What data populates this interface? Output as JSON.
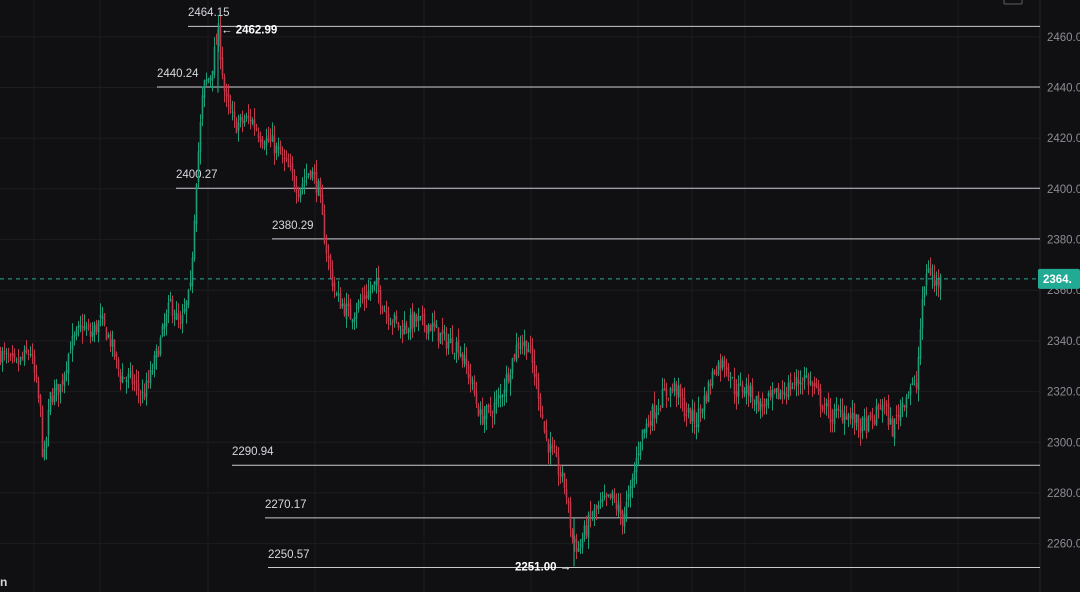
{
  "colors": {
    "background": "#101013",
    "grid": "#1d1d21",
    "level_line": "#c9c9cf",
    "up_candle": "#1e9c78",
    "down_candle": "#c0394a",
    "price_line": "#22ab94",
    "price_tag": "#22ab94"
  },
  "corner_text": "n",
  "icons": {
    "scale_settings": "square-icon"
  },
  "chart_data": {
    "type": "candlestick",
    "title": "",
    "xlabel": "",
    "ylabel": "",
    "ylim": [
      2248,
      2472
    ],
    "grid": true,
    "y_ticks": [
      "2260.00",
      "2280.00",
      "2300.00",
      "2320.00",
      "2340.00",
      "2360.00",
      "2380.00",
      "2400.00",
      "2420.00",
      "2440.00",
      "2460.00"
    ],
    "current_price": {
      "value": 2364.5,
      "label": "2364."
    },
    "levels": [
      {
        "value": 2464.15,
        "label": "2464.15"
      },
      {
        "value": 2440.24,
        "label": "2440.24"
      },
      {
        "value": 2400.27,
        "label": "2400.27"
      },
      {
        "value": 2380.29,
        "label": "2380.29"
      },
      {
        "value": 2290.94,
        "label": "2290.94"
      },
      {
        "value": 2270.17,
        "label": "2270.17"
      },
      {
        "value": 2250.57,
        "label": "2250.57"
      }
    ],
    "extreme_labels": [
      {
        "type": "high",
        "value": 2462.99,
        "text": "← 2462.99"
      },
      {
        "type": "low",
        "value": 2251.0,
        "text": "2251.00 →"
      }
    ],
    "price_path": [
      [
        0,
        2335
      ],
      [
        15,
        2330
      ],
      [
        30,
        2336
      ],
      [
        40,
        2312
      ],
      [
        43,
        2290
      ],
      [
        50,
        2318
      ],
      [
        60,
        2322
      ],
      [
        70,
        2338
      ],
      [
        82,
        2346
      ],
      [
        90,
        2342
      ],
      [
        100,
        2348
      ],
      [
        110,
        2340
      ],
      [
        120,
        2326
      ],
      [
        130,
        2325
      ],
      [
        143,
        2318
      ],
      [
        150,
        2326
      ],
      [
        160,
        2340
      ],
      [
        170,
        2355
      ],
      [
        180,
        2345
      ],
      [
        190,
        2360
      ],
      [
        196,
        2405
      ],
      [
        203,
        2440
      ],
      [
        210,
        2445
      ],
      [
        218,
        2462
      ],
      [
        225,
        2435
      ],
      [
        235,
        2425
      ],
      [
        250,
        2428
      ],
      [
        262,
        2420
      ],
      [
        272,
        2418
      ],
      [
        285,
        2410
      ],
      [
        298,
        2400
      ],
      [
        310,
        2408
      ],
      [
        318,
        2400
      ],
      [
        325,
        2378
      ],
      [
        335,
        2358
      ],
      [
        350,
        2350
      ],
      [
        365,
        2358
      ],
      [
        375,
        2362
      ],
      [
        385,
        2352
      ],
      [
        400,
        2345
      ],
      [
        415,
        2348
      ],
      [
        430,
        2346
      ],
      [
        445,
        2340
      ],
      [
        458,
        2338
      ],
      [
        470,
        2325
      ],
      [
        480,
        2310
      ],
      [
        490,
        2312
      ],
      [
        500,
        2318
      ],
      [
        510,
        2330
      ],
      [
        518,
        2340
      ],
      [
        528,
        2338
      ],
      [
        538,
        2320
      ],
      [
        545,
        2302
      ],
      [
        555,
        2292
      ],
      [
        565,
        2282
      ],
      [
        572,
        2262
      ],
      [
        578,
        2258
      ],
      [
        590,
        2270
      ],
      [
        600,
        2275
      ],
      [
        612,
        2278
      ],
      [
        622,
        2270
      ],
      [
        630,
        2280
      ],
      [
        640,
        2302
      ],
      [
        650,
        2310
      ],
      [
        662,
        2318
      ],
      [
        675,
        2322
      ],
      [
        685,
        2312
      ],
      [
        695,
        2308
      ],
      [
        705,
        2318
      ],
      [
        715,
        2330
      ],
      [
        725,
        2332
      ],
      [
        735,
        2320
      ],
      [
        745,
        2322
      ],
      [
        760,
        2314
      ],
      [
        775,
        2318
      ],
      [
        790,
        2322
      ],
      [
        805,
        2326
      ],
      [
        815,
        2320
      ],
      [
        830,
        2310
      ],
      [
        845,
        2312
      ],
      [
        860,
        2306
      ],
      [
        872,
        2308
      ],
      [
        882,
        2316
      ],
      [
        892,
        2305
      ],
      [
        900,
        2314
      ],
      [
        910,
        2322
      ],
      [
        916,
        2322
      ],
      [
        920,
        2345
      ],
      [
        924,
        2362
      ],
      [
        928,
        2370
      ],
      [
        934,
        2362
      ],
      [
        940,
        2364
      ]
    ]
  }
}
